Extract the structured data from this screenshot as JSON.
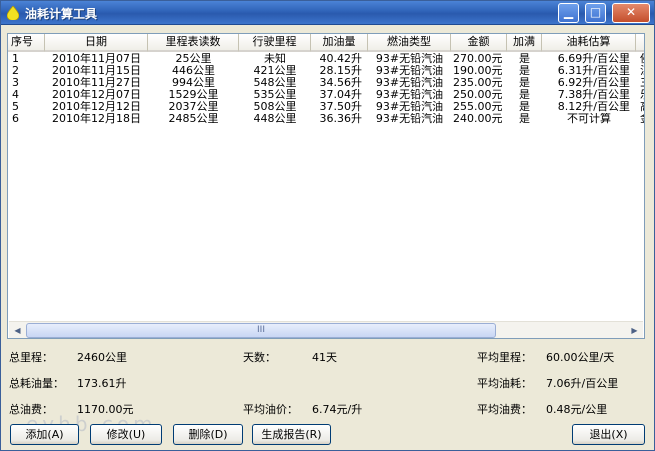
{
  "window": {
    "title": "油耗计算工具",
    "min_glyph": "▁",
    "max_glyph": "□",
    "close_glyph": "✕"
  },
  "table": {
    "columns": [
      "序号",
      "日期",
      "里程表读数",
      "行驶里程",
      "加油量",
      "燃油类型",
      "金额",
      "加满",
      "油耗估算",
      "加"
    ],
    "rows": [
      [
        "1",
        "2010年11月07日",
        "25公里",
        "未知",
        "40.42升",
        "93#无铅汽油",
        "270.00元",
        "是",
        "6.69升/百公里",
        "佛"
      ],
      [
        "2",
        "2010年11月15日",
        "446公里",
        "421公里",
        "28.15升",
        "93#无铅汽油",
        "190.00元",
        "是",
        "6.31升/百公里",
        "江"
      ],
      [
        "3",
        "2010年11月27日",
        "994公里",
        "548公里",
        "34.56升",
        "93#无铅汽油",
        "235.00元",
        "是",
        "6.92升/百公里",
        "三"
      ],
      [
        "4",
        "2010年12月07日",
        "1529公里",
        "535公里",
        "37.04升",
        "93#无铅汽油",
        "250.00元",
        "是",
        "7.38升/百公里",
        "乐"
      ],
      [
        "5",
        "2010年12月12日",
        "2037公里",
        "508公里",
        "37.50升",
        "93#无铅汽油",
        "255.00元",
        "是",
        "8.12升/百公里",
        "高"
      ],
      [
        "6",
        "2010年12月18日",
        "2485公里",
        "448公里",
        "36.36升",
        "93#无铅汽油",
        "240.00元",
        "是",
        "不可计算",
        "金"
      ]
    ],
    "scroll_left": "◀",
    "scroll_right": "▶",
    "thumb_grip": "III"
  },
  "stats": {
    "total_distance_label": "总里程：",
    "total_distance": "2460公里",
    "days_label": "天数：",
    "days": "41天",
    "avg_distance_label": "平均里程：",
    "avg_distance": "60.00公里/天",
    "total_fuel_label": "总耗油量：",
    "total_fuel": "173.61升",
    "avg_consumption_label": "平均油耗：",
    "avg_consumption": "7.06升/百公里",
    "total_cost_label": "总油费：",
    "total_cost": "1170.00元",
    "avg_price_label": "平均油价：",
    "avg_price": "6.74元/升",
    "avg_cost_label": "平均油费：",
    "avg_cost": "0.48元/公里"
  },
  "buttons": {
    "add": "添加(A)",
    "edit": "修改(U)",
    "delete": "删除(D)",
    "report": "生成报告(R)",
    "exit": "退出(X)"
  },
  "watermark": "eyhb.com"
}
